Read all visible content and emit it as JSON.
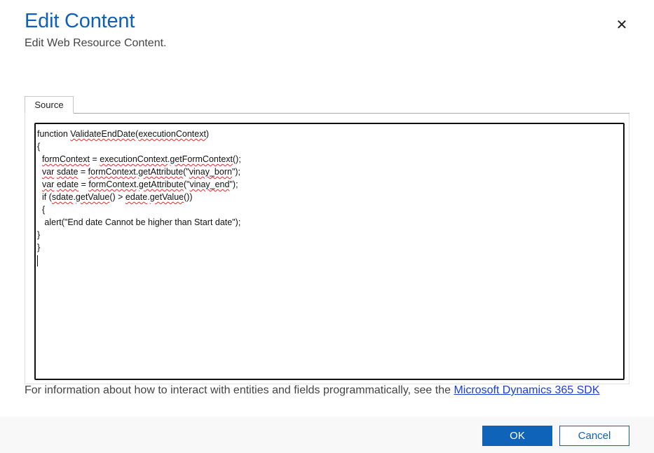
{
  "dialog": {
    "title": "Edit Content",
    "subtitle": "Edit Web Resource Content.",
    "close_icon": "close-icon"
  },
  "tabs": [
    {
      "label": "Source"
    }
  ],
  "editor": {
    "lines": [
      "function ValidateEndDate(executionContext)",
      "{",
      "  formContext = executionContext.getFormContext();",
      "  var sdate = formContext.getAttribute(\"vinay_born\");",
      "  var edate = formContext.getAttribute(\"vinay_end\");",
      "  if (sdate.getValue() > edate.getValue())",
      "  {",
      "   alert(\"End date Cannot be higher than Start date\");",
      "}",
      "}"
    ]
  },
  "info": {
    "text": "For information about how to interact with entities and fields programmatically, see the ",
    "link_text": "Microsoft Dynamics 365 SDK"
  },
  "footer": {
    "ok_label": "OK",
    "cancel_label": "Cancel"
  },
  "colors": {
    "title": "#1160b7",
    "primary_button": "#0f63b9",
    "spellcheck_underline": "#d9312b"
  }
}
